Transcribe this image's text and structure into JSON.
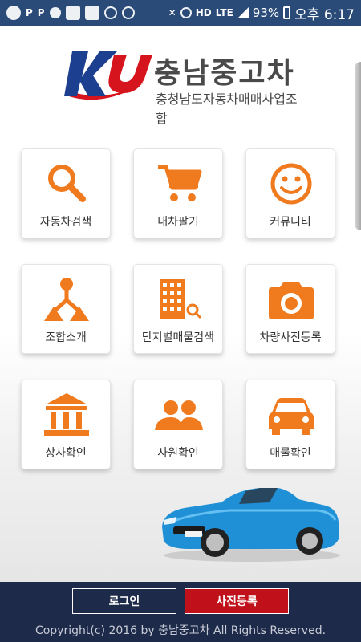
{
  "status_bar": {
    "battery": "93%",
    "network": "LTE",
    "time": "오후 6:17"
  },
  "logo": {
    "mark": "KU",
    "name": "충남중고차",
    "subtitle": "충청남도자동차매매사업조합"
  },
  "colors": {
    "accent": "#f07a1e",
    "footer_bg": "#1e2a4a",
    "photo_button": "#c0111a",
    "logo_blue": "#1d3f8f",
    "logo_red": "#d6141d"
  },
  "menu": [
    {
      "label": "자동차검색",
      "icon": "search-icon"
    },
    {
      "label": "내차팔기",
      "icon": "cart-icon"
    },
    {
      "label": "커뮤니티",
      "icon": "smiley-icon"
    },
    {
      "label": "조합소개",
      "icon": "hierarchy-icon"
    },
    {
      "label": "단지별매물검색",
      "icon": "building-search-icon"
    },
    {
      "label": "차량사진등록",
      "icon": "camera-icon"
    },
    {
      "label": "상사확인",
      "icon": "bank-icon"
    },
    {
      "label": "사원확인",
      "icon": "people-icon"
    },
    {
      "label": "매물확인",
      "icon": "car-icon"
    }
  ],
  "footer": {
    "login_label": "로그인",
    "photo_label": "사진등록",
    "copyright": "Copyright(c) 2016 by 충남중고차 All Rights Reserved."
  }
}
